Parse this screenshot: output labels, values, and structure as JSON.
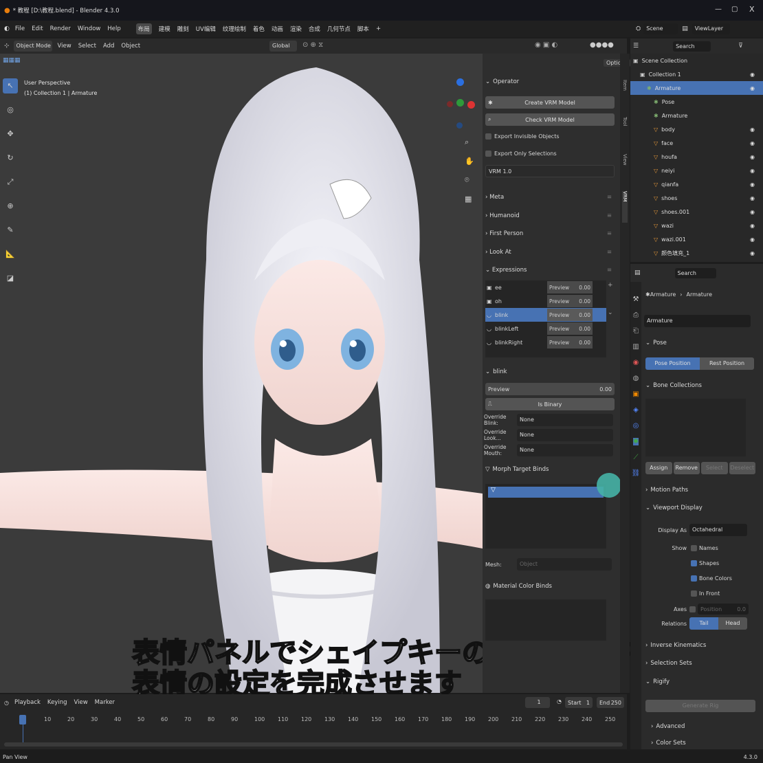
{
  "window": {
    "title": "* 教程 [D:\\教程.blend] - Blender 4.3.0",
    "min": "—",
    "max": "▢",
    "close": "X"
  },
  "menu": [
    "File",
    "Edit",
    "Render",
    "Window",
    "Help"
  ],
  "workspaces": [
    "布局",
    "建模",
    "雕刻",
    "UV编辑",
    "纹理绘制",
    "着色",
    "动画",
    "渲染",
    "合成",
    "几何节点",
    "脚本",
    "+"
  ],
  "scene": {
    "name": "Scene",
    "viewlayer": "ViewLayer"
  },
  "viewport": {
    "mode": "Object Mode",
    "view": "View",
    "select": "Select",
    "add": "Add",
    "object": "Object",
    "orientation": "Global",
    "options": "Options",
    "info_line1": "User Perspective",
    "info_line2": "(1) Collection 1 | Armature"
  },
  "vrm": {
    "operator": "Operator",
    "create": "Create VRM Model",
    "check": "Check VRM Model",
    "export_invisible": "Export Invisible Objects",
    "export_selected": "Export Only Selections",
    "version": "VRM 1.0",
    "sections": [
      "Meta",
      "Humanoid",
      "First Person",
      "Look At",
      "Expressions"
    ],
    "expressions": [
      {
        "name": "ee",
        "preview": "Preview",
        "value": "0.00"
      },
      {
        "name": "oh",
        "preview": "Preview",
        "value": "0.00"
      },
      {
        "name": "blink",
        "preview": "Preview",
        "value": "0.00"
      },
      {
        "name": "blinkLeft",
        "preview": "Preview",
        "value": "0.00"
      },
      {
        "name": "blinkRight",
        "preview": "Preview",
        "value": "0.00"
      }
    ],
    "sel_name": "blink",
    "preview_label": "Preview",
    "preview_value": "0.00",
    "is_binary": "Is Binary",
    "override_blink": "Override Blink:",
    "override_look": "Override Look...",
    "override_mouth": "Override Mouth:",
    "none": "None",
    "morph": "Morph Target Binds",
    "mesh": "Mesh:",
    "mesh_placeholder": "Object",
    "material": "Material Color Binds"
  },
  "ntabs": [
    "Item",
    "Tool",
    "View",
    "VRM"
  ],
  "outliner": {
    "search": "Search",
    "items": [
      {
        "name": "Scene Collection",
        "depth": 0
      },
      {
        "name": "Collection 1",
        "depth": 1
      },
      {
        "name": "Armature",
        "depth": 2,
        "sel": true
      },
      {
        "name": "Pose",
        "depth": 3
      },
      {
        "name": "Armature",
        "depth": 3
      },
      {
        "name": "body",
        "depth": 3
      },
      {
        "name": "face",
        "depth": 3
      },
      {
        "name": "houfa",
        "depth": 3
      },
      {
        "name": "neiyi",
        "depth": 3
      },
      {
        "name": "qianfa",
        "depth": 3
      },
      {
        "name": "shoes",
        "depth": 3
      },
      {
        "name": "shoes.001",
        "depth": 3
      },
      {
        "name": "wazi",
        "depth": 3
      },
      {
        "name": "wazi.001",
        "depth": 3
      },
      {
        "name": "颜色填充_1",
        "depth": 3
      }
    ]
  },
  "properties": {
    "search": "Search",
    "crumb1": "Armature",
    "crumb2": "Armature",
    "name": "Armature",
    "pose": "Pose",
    "pose_pos": "Pose Position",
    "rest_pos": "Rest Position",
    "bone_coll": "Bone Collections",
    "assign": "Assign",
    "remove": "Remove",
    "select": "Select",
    "deselect": "Deselect",
    "motion": "Motion Paths",
    "vdisplay": "Viewport Display",
    "display_as": "Display As",
    "display_val": "Octahedral",
    "show": "Show",
    "names": "Names",
    "shapes": "Shapes",
    "bone_colors": "Bone Colors",
    "in_front": "In Front",
    "axes": "Axes",
    "position": "Position",
    "axes_val": "0.0",
    "relations": "Relations",
    "tail": "Tail",
    "head": "Head",
    "ik": "Inverse Kinematics",
    "selsets": "Selection Sets",
    "rigify": "Rigify",
    "gen_rig": "Generate Rig",
    "advanced": "Advanced",
    "colorsets": "Color Sets"
  },
  "timeline": {
    "playback": "Playback",
    "keying": "Keying",
    "view": "View",
    "marker": "Marker",
    "frame": "1",
    "start_label": "Start",
    "start": "1",
    "end_label": "End",
    "end": "250",
    "ticks": [
      "1",
      "10",
      "20",
      "30",
      "40",
      "50",
      "60",
      "70",
      "80",
      "90",
      "100",
      "110",
      "120",
      "130",
      "140",
      "150",
      "160",
      "170",
      "180",
      "190",
      "200",
      "210",
      "220",
      "230",
      "240",
      "250"
    ]
  },
  "subtitle": {
    "line1": "表情パネルでシェイプキーの組み合わせを追加して",
    "line2": "表情の設定を完成させます"
  },
  "status": {
    "left": "Pan View",
    "version": "4.3.0"
  }
}
